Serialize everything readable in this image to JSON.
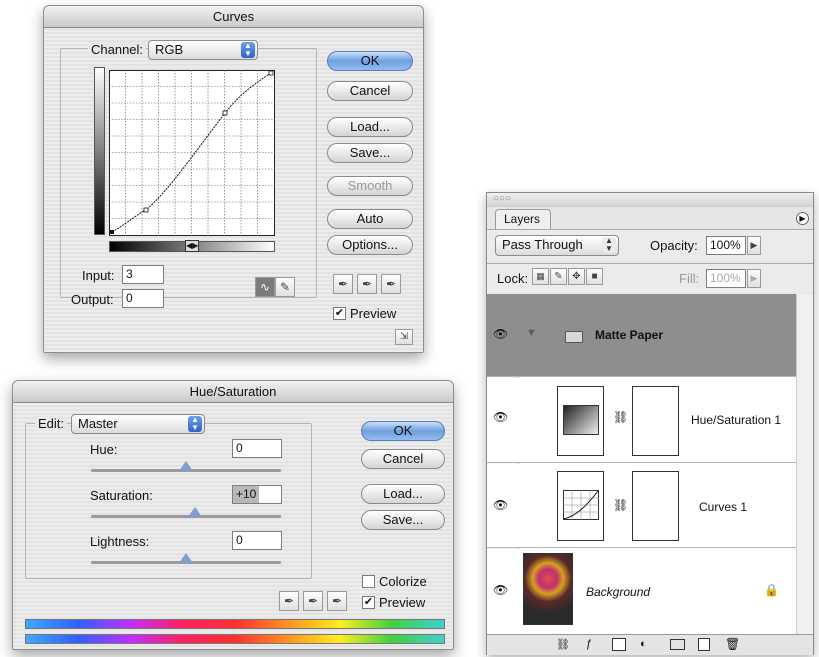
{
  "curves": {
    "title": "Curves",
    "channel_label": "Channel:",
    "channel_value": "RGB",
    "ok": "OK",
    "cancel": "Cancel",
    "load": "Load...",
    "save": "Save...",
    "smooth": "Smooth",
    "auto": "Auto",
    "options": "Options...",
    "input_label": "Input:",
    "input_value": "3",
    "output_label": "Output:",
    "output_value": "0",
    "preview_label": "Preview",
    "preview_checked": "✔"
  },
  "hue_sat": {
    "title": "Hue/Saturation",
    "edit_label": "Edit:",
    "edit_value": "Master",
    "hue_label": "Hue:",
    "hue_value": "0",
    "hue_level": 0.5,
    "saturation_label": "Saturation:",
    "saturation_value": "+10",
    "saturation_level": 0.55,
    "lightness_label": "Lightness:",
    "lightness_value": "0",
    "lightness_level": 0.5,
    "ok": "OK",
    "cancel": "Cancel",
    "load": "Load...",
    "save": "Save...",
    "colorize_label": "Colorize",
    "preview_label": "Preview",
    "preview_checked": "✔"
  },
  "layers": {
    "tab_label": "Layers",
    "blend_mode": "Pass Through",
    "opacity_label": "Opacity:",
    "opacity_value": "100%",
    "lock_label": "Lock:",
    "fill_label": "Fill:",
    "fill_value": "100%",
    "rows": [
      {
        "name": "Matte Paper"
      },
      {
        "name": "Hue/Saturation 1"
      },
      {
        "name": "Curves 1"
      },
      {
        "name": "Background"
      }
    ]
  },
  "icons": {
    "eye": "👁",
    "lock": "🔒",
    "chain": "⛓",
    "folder": "folder-icon",
    "trash": "trash-icon"
  },
  "colors": {
    "default_button": "#6f9fe0",
    "selected_layer": "#8e8e8e"
  }
}
